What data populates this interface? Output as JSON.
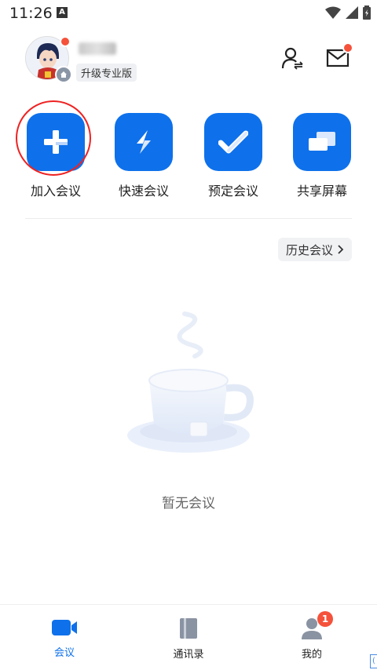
{
  "status_bar": {
    "time": "11:26",
    "indicator": "A"
  },
  "header": {
    "upgrade_label": "升级专业版",
    "contact_icon": "contact-sync-icon",
    "mail_icon": "mail-icon"
  },
  "actions": [
    {
      "label": "加入会议",
      "icon": "plus-icon",
      "color": "#0e71eb"
    },
    {
      "label": "快速会议",
      "icon": "lightning-icon",
      "color": "#0e71eb"
    },
    {
      "label": "预定会议",
      "icon": "check-icon",
      "color": "#0e71eb"
    },
    {
      "label": "共享屏幕",
      "icon": "screen-share-icon",
      "color": "#0e71eb"
    }
  ],
  "history": {
    "label": "历史会议"
  },
  "empty_state": {
    "text": "暂无会议"
  },
  "bottom_nav": {
    "items": [
      {
        "label": "会议",
        "icon": "video-icon",
        "active": true
      },
      {
        "label": "通讯录",
        "icon": "contacts-book-icon",
        "active": false
      },
      {
        "label": "我的",
        "icon": "person-icon",
        "active": false,
        "badge": "1"
      }
    ],
    "active_color": "#0e71eb"
  }
}
